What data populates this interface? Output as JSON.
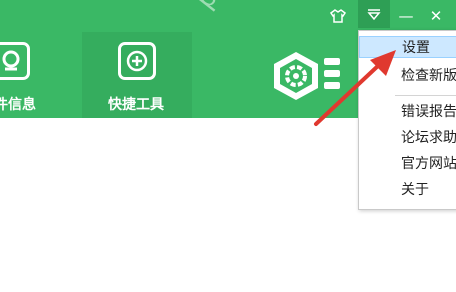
{
  "tabs": [
    {
      "label": "件信息",
      "icon": "monitor-search-icon"
    },
    {
      "label": "快捷工具",
      "icon": "toolbox-icon"
    }
  ],
  "titlebar": {
    "skin_icon": "shirt-icon",
    "menu_icon": "dropdown-triangle-icon",
    "minimize": "—",
    "close": "✕"
  },
  "menu": {
    "items": [
      {
        "label": "设置",
        "active": true
      },
      {
        "label": "检查新版",
        "active": false
      },
      {
        "label": "错误报告",
        "active": false
      },
      {
        "label": "论坛求助",
        "active": false
      },
      {
        "label": "官方网站",
        "active": false
      },
      {
        "label": "关于",
        "active": false
      }
    ]
  },
  "watermark": "php.cn",
  "colors": {
    "header_green": "#3ab865",
    "arrow_red": "#e0392f",
    "menu_highlight": "#cde8ff"
  }
}
